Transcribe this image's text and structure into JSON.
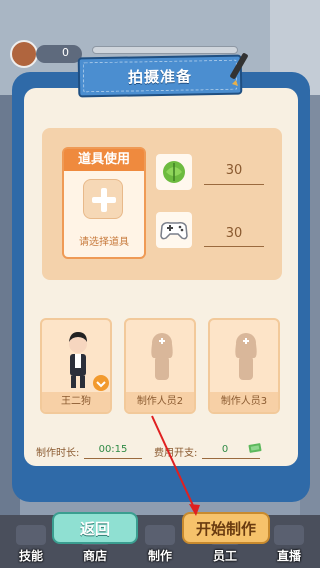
{
  "hud": {
    "coin_count": "0"
  },
  "panel": {
    "title": "拍摄准备"
  },
  "props": {
    "header": "道具使用",
    "select_label": "请选择道具",
    "items": [
      {
        "icon": "cabbage-icon",
        "value": "30"
      },
      {
        "icon": "gamepad-icon",
        "value": "30"
      }
    ]
  },
  "staff": [
    {
      "name": "王二狗",
      "filled": true
    },
    {
      "name": "制作人员2",
      "filled": false
    },
    {
      "name": "制作人员3",
      "filled": false
    }
  ],
  "stats": {
    "duration_label": "制作时长:",
    "duration_value": "00:15",
    "cost_label": "费用开支:",
    "cost_value": "0"
  },
  "buttons": {
    "back": "返回",
    "start": "开始制作"
  },
  "nav": [
    {
      "label": "技能",
      "icon": "skills-icon"
    },
    {
      "label": "商店",
      "icon": "shop-icon"
    },
    {
      "label": "制作",
      "icon": "production-icon"
    },
    {
      "label": "员工",
      "icon": "staff-icon"
    },
    {
      "label": "直播",
      "icon": "livestream-icon"
    }
  ],
  "colors": {
    "panel_blue": "#2f6aa8",
    "accent_orange": "#ef8a3e",
    "cost_green": "#2f8a45",
    "arrow_red": "#e02020"
  }
}
